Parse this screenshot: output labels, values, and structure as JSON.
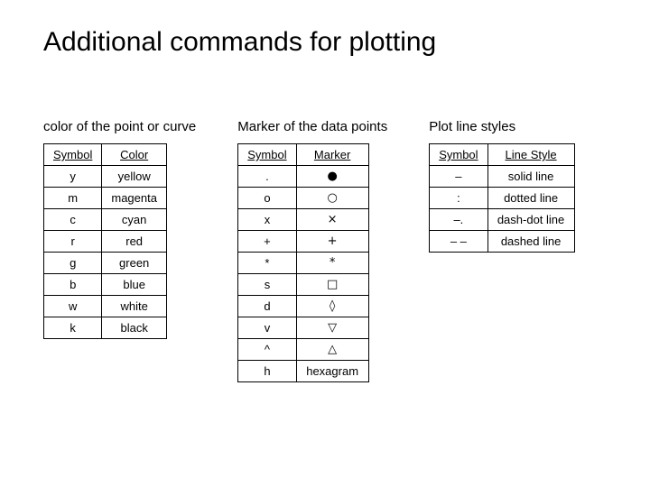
{
  "title": "Additional commands for plotting",
  "colorTable": {
    "caption": "color of the point or curve",
    "headers": [
      "Symbol",
      "Color"
    ],
    "rows": [
      [
        "y",
        "yellow"
      ],
      [
        "m",
        "magenta"
      ],
      [
        "c",
        "cyan"
      ],
      [
        "r",
        "red"
      ],
      [
        "g",
        "green"
      ],
      [
        "b",
        "blue"
      ],
      [
        "w",
        "white"
      ],
      [
        "k",
        "black"
      ]
    ]
  },
  "markerTable": {
    "caption": "Marker of the data points",
    "headers": [
      "Symbol",
      "Marker"
    ],
    "rows": [
      [
        ".",
        "●"
      ],
      [
        "o",
        "○"
      ],
      [
        "x",
        "×"
      ],
      [
        "+",
        "+"
      ],
      [
        "*",
        "*"
      ],
      [
        "s",
        "□"
      ],
      [
        "d",
        "◊"
      ],
      [
        "v",
        "▽"
      ],
      [
        "^",
        "△"
      ],
      [
        "h",
        "hexagram"
      ]
    ]
  },
  "lineTable": {
    "caption": "Plot line styles",
    "headers": [
      "Symbol",
      "Line Style"
    ],
    "rows": [
      [
        "–",
        "solid line"
      ],
      [
        ":",
        "dotted line"
      ],
      [
        "–.",
        "dash-dot line"
      ],
      [
        "– –",
        "dashed line"
      ]
    ]
  }
}
